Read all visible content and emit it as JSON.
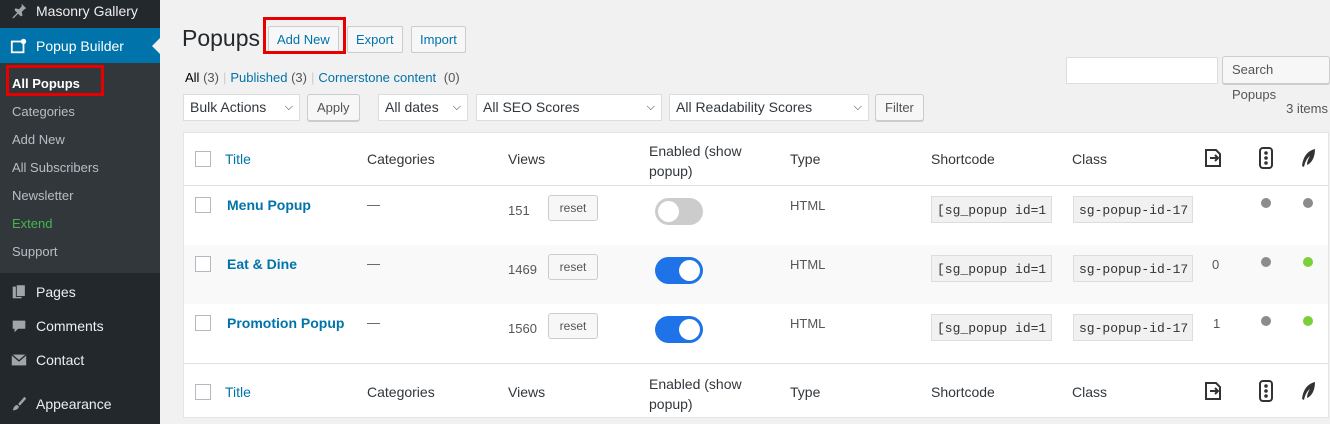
{
  "sidebar": {
    "top_items": [
      {
        "label": "Masonry Gallery",
        "icon": "pin-icon"
      },
      {
        "label": "Popup Builder",
        "icon": "popup-icon"
      }
    ],
    "submenu": [
      {
        "label": "All Popups"
      },
      {
        "label": "Categories"
      },
      {
        "label": "Add New"
      },
      {
        "label": "All Subscribers"
      },
      {
        "label": "Newsletter"
      },
      {
        "label": "Extend"
      },
      {
        "label": "Support"
      }
    ],
    "bottom_items": [
      {
        "label": "Pages",
        "icon": "pages-icon"
      },
      {
        "label": "Comments",
        "icon": "comment-icon"
      },
      {
        "label": "Contact",
        "icon": "mail-icon"
      },
      {
        "label": "Appearance",
        "icon": "brush-icon"
      }
    ]
  },
  "page": {
    "title": "Popups",
    "add_new": "Add New",
    "export": "Export",
    "import": "Import"
  },
  "filters_links": {
    "all": "All",
    "all_count": "(3)",
    "published": "Published",
    "published_count": "(3)",
    "cornerstone": "Cornerstone content",
    "cornerstone_count": "(0)"
  },
  "search": {
    "button": "Search Popups",
    "value": ""
  },
  "toolbar": {
    "bulk_actions": "Bulk Actions",
    "apply": "Apply",
    "dates": "All dates",
    "seo": "All SEO Scores",
    "readability": "All Readability Scores",
    "filter": "Filter",
    "items_count": "3 items"
  },
  "columns": {
    "title": "Title",
    "categories": "Categories",
    "views": "Views",
    "enabled_line1": "Enabled (show",
    "enabled_line2": "popup)",
    "type": "Type",
    "shortcode": "Shortcode",
    "class": "Class"
  },
  "rows": [
    {
      "title": "Menu Popup",
      "categories": "—",
      "views": "151",
      "reset": "reset",
      "enabled": false,
      "type": "HTML",
      "shortcode": "[sg_popup id=1",
      "class": "sg-popup-id-17",
      "links": "",
      "seo": "gray",
      "readability": "gray"
    },
    {
      "title": "Eat & Dine",
      "categories": "—",
      "views": "1469",
      "reset": "reset",
      "enabled": true,
      "type": "HTML",
      "shortcode": "[sg_popup id=1",
      "class": "sg-popup-id-17",
      "links": "0",
      "seo": "gray",
      "readability": "green"
    },
    {
      "title": "Promotion Popup",
      "categories": "—",
      "views": "1560",
      "reset": "reset",
      "enabled": true,
      "type": "HTML",
      "shortcode": "[sg_popup id=1",
      "class": "sg-popup-id-17",
      "links": "1",
      "seo": "gray",
      "readability": "green"
    }
  ],
  "colors": {
    "sidebar_bg": "#23282d",
    "accent": "#0073aa",
    "toggle_on": "#1e73e8",
    "dot_gray": "#8c8c8c",
    "dot_green": "#7ad03a",
    "highlight_red": "#e60000"
  }
}
